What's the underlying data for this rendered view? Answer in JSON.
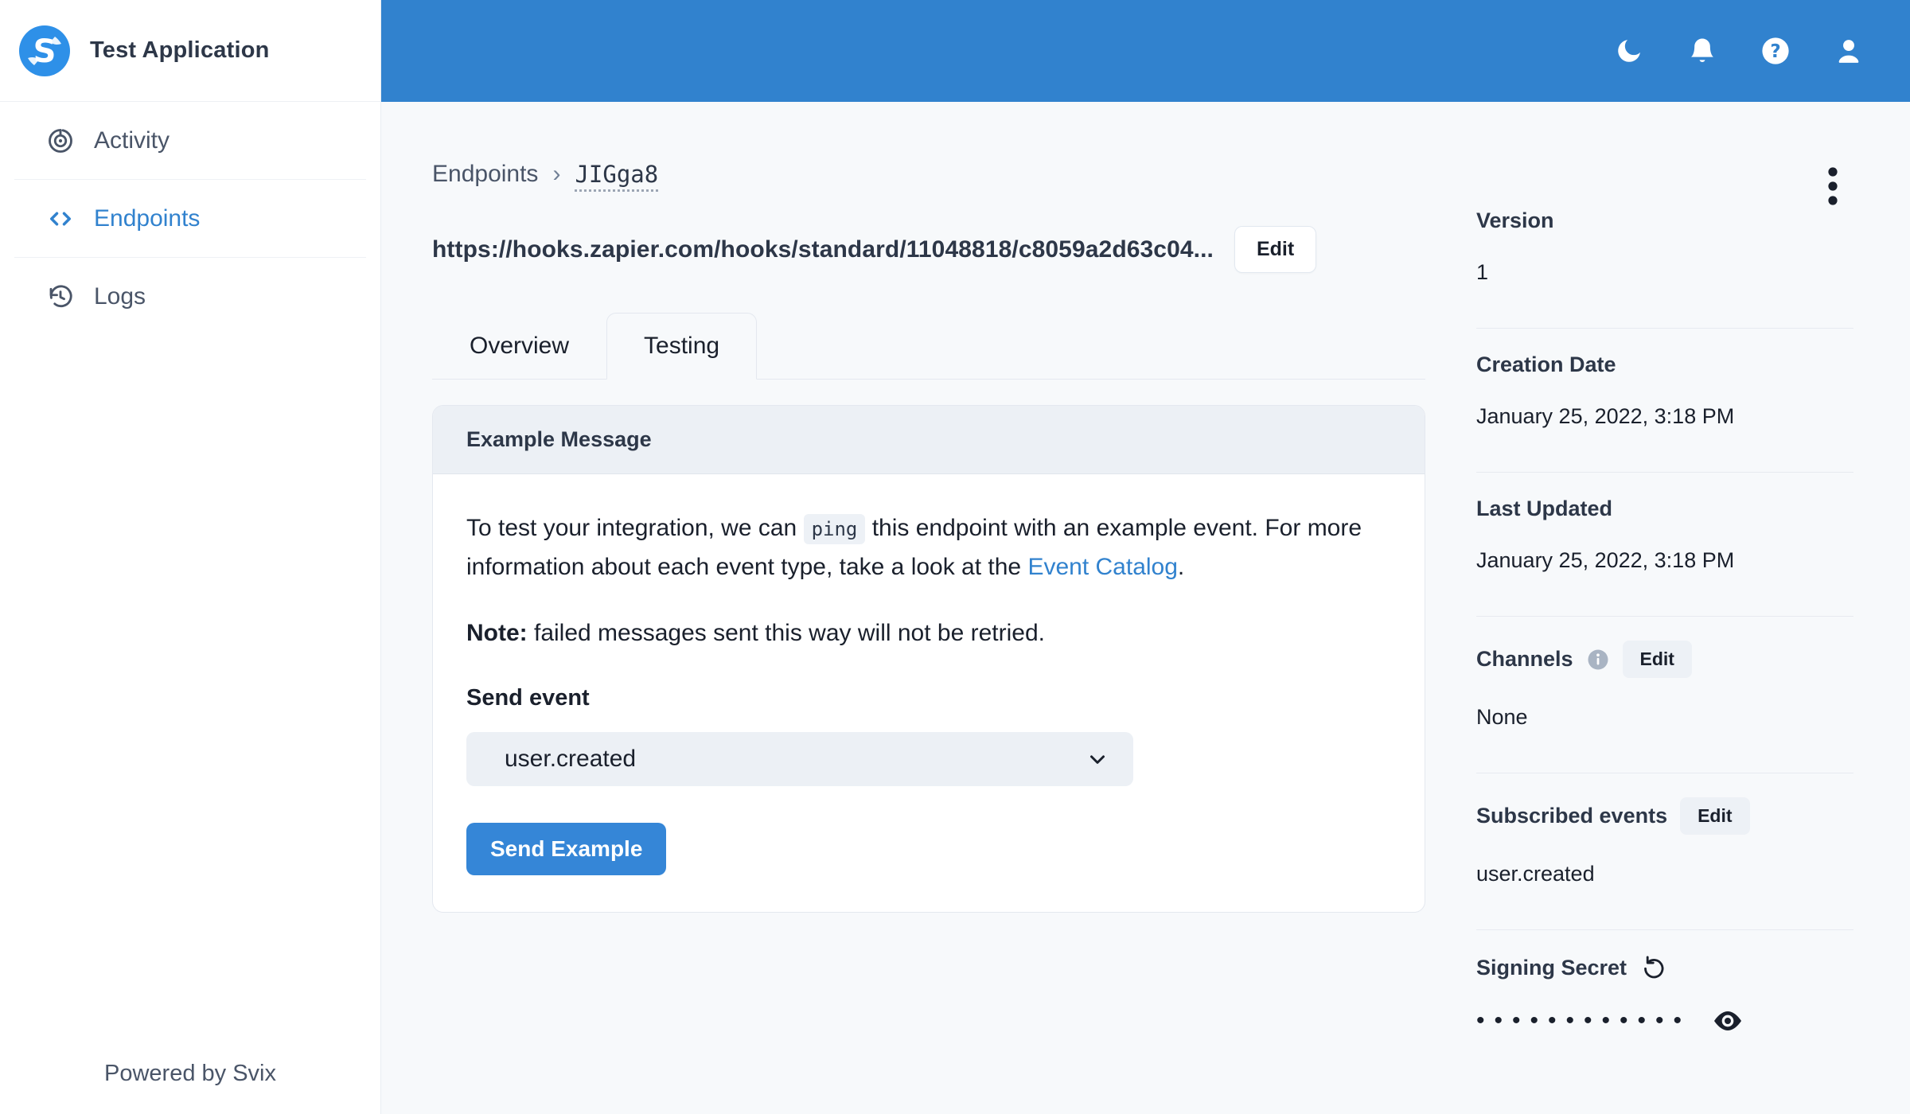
{
  "app": {
    "name": "Test Application",
    "powered_by": "Powered by Svix"
  },
  "sidebar": {
    "items": [
      {
        "label": "Activity",
        "icon": "activity-icon",
        "active": false
      },
      {
        "label": "Endpoints",
        "icon": "code-brackets-icon",
        "active": true
      },
      {
        "label": "Logs",
        "icon": "history-clock-icon",
        "active": false
      }
    ]
  },
  "topbar": {
    "icons": [
      "moon-icon",
      "bell-icon",
      "help-icon",
      "user-icon"
    ]
  },
  "breadcrumb": {
    "root": "Endpoints",
    "separator": "›",
    "current": "JIGga8"
  },
  "endpoint": {
    "url": "https://hooks.zapier.com/hooks/standard/11048818/c8059a2d63c04...",
    "edit_label": "Edit"
  },
  "tabs": [
    {
      "label": "Overview",
      "active": false
    },
    {
      "label": "Testing",
      "active": true
    }
  ],
  "testing_card": {
    "header": "Example Message",
    "intro_before_code": "To test your integration, we can",
    "code": "ping",
    "intro_after_code": "this endpoint with an example event. For more information about each event type, take a look at the",
    "link_text": "Event Catalog",
    "intro_end": ".",
    "note_label": "Note:",
    "note_text": " failed messages sent this way will not be retried.",
    "send_event_label": "Send event",
    "selected_event": "user.created",
    "send_button_label": "Send Example"
  },
  "details": {
    "version": {
      "label": "Version",
      "value": "1"
    },
    "creation_date": {
      "label": "Creation Date",
      "value": "January 25, 2022, 3:18 PM"
    },
    "last_updated": {
      "label": "Last Updated",
      "value": "January 25, 2022, 3:18 PM"
    },
    "channels": {
      "label": "Channels",
      "edit_label": "Edit",
      "value": "None"
    },
    "subscribed_events": {
      "label": "Subscribed events",
      "edit_label": "Edit",
      "value": "user.created"
    },
    "signing_secret": {
      "label": "Signing Secret",
      "masked_value": "••••••••••••"
    }
  },
  "colors": {
    "accent_blue": "#3182CE",
    "logo_blue": "#2E90E8",
    "link_blue": "#3182CE",
    "dark_text": "#1A202C",
    "muted_text": "#4A5568",
    "border": "#E4E8EF",
    "chip_bg": "#EDF1F6"
  }
}
